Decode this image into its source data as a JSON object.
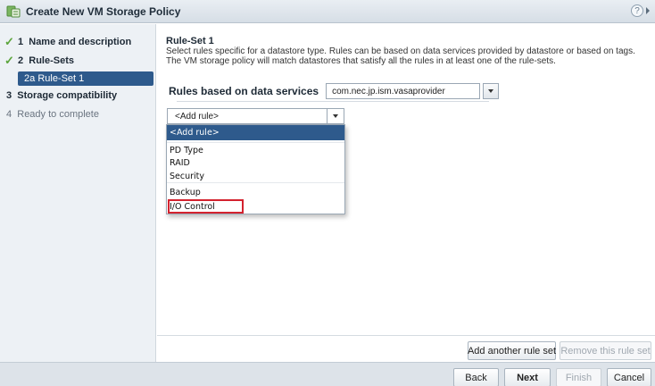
{
  "window": {
    "title": "Create New VM Storage Policy",
    "help_icon": "?"
  },
  "sidebar": {
    "steps": [
      {
        "number": "1",
        "label": "Name and description",
        "status": "complete"
      },
      {
        "number": "2",
        "label": "Rule-Sets",
        "status": "complete"
      },
      {
        "number": "2a",
        "label": "Rule-Set 1",
        "status": "current"
      },
      {
        "number": "3",
        "label": "Storage compatibility",
        "status": "pending"
      },
      {
        "number": "4",
        "label": "Ready to complete",
        "status": "disabled"
      }
    ]
  },
  "main": {
    "ruleset_title": "Rule-Set 1",
    "description_line1": "Select rules specific for a datastore type. Rules can be based on data services provided by datastore or based on tags.",
    "description_line2": "The VM storage policy will match datastores that satisfy all the rules in at least one of the rule-sets.",
    "rules_label": "Rules based on data services",
    "provider_value": "com.nec.jp.ism.vasaprovider",
    "add_rule_value": "<Add rule>",
    "dropdown_options": [
      "<Add rule>",
      "PD Type",
      "RAID",
      "Security",
      "Backup",
      "I/O Control"
    ],
    "highlighted_option": "I/O Control",
    "add_ruleset_button": "Add another rule set",
    "remove_ruleset_button": "Remove this rule set"
  },
  "footer": {
    "back": "Back",
    "next": "Next",
    "finish": "Finish",
    "cancel": "Cancel"
  },
  "colors": {
    "accent": "#2e5a8c",
    "check": "#5ca53c",
    "highlight_border": "#d3222e"
  }
}
